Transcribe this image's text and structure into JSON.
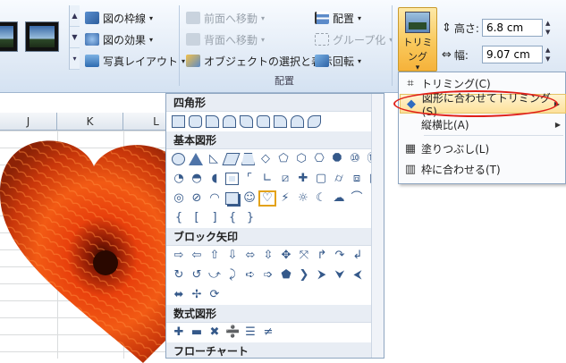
{
  "ribbon": {
    "picture_styles": {
      "border_label": "図の枠線",
      "effects_label": "図の効果",
      "layout_label": "写真レイアウト"
    },
    "arrange": {
      "bring_forward_label": "前面へ移動",
      "send_backward_label": "背面へ移動",
      "selection_pane_label": "オブジェクトの選択と表示",
      "align_label": "配置",
      "group_label": "グループ化",
      "rotate_label": "回転",
      "group_title": "配置"
    },
    "size": {
      "crop_button_label": "トリミング",
      "height_label": "高さ:",
      "height_value": "6.8 cm",
      "width_label": "幅:",
      "width_value": "9.07 cm"
    }
  },
  "sheet": {
    "columns": [
      "J",
      "K",
      "L"
    ]
  },
  "shapes_gallery": {
    "categories": {
      "rectangles": "四角形",
      "basic_shapes": "基本図形",
      "block_arrows": "ブロック矢印",
      "equation_shapes": "数式図形",
      "flowchart": "フローチャート"
    },
    "equation_glyphs": [
      "✚",
      "▬",
      "✖",
      "➗",
      "☰",
      "≠"
    ],
    "basic_glyphs_row4": [
      "{",
      "}",
      "[",
      "]",
      "{",
      "}"
    ]
  },
  "crop_menu": {
    "items": [
      {
        "label": "トリミング(C)",
        "icon": "crop-icon"
      },
      {
        "label": "図形に合わせてトリミング(S)",
        "icon": "crop-to-shape-icon"
      },
      {
        "label": "縦横比(A)",
        "icon": ""
      },
      {
        "label": "塗りつぶし(L)",
        "icon": "fill-icon"
      },
      {
        "label": "枠に合わせる(T)",
        "icon": "fit-icon"
      }
    ]
  },
  "colors": {
    "ribbon_bg": "#dfe9f5",
    "highlight": "#fde19a",
    "annotation_ring": "#e0201a"
  }
}
